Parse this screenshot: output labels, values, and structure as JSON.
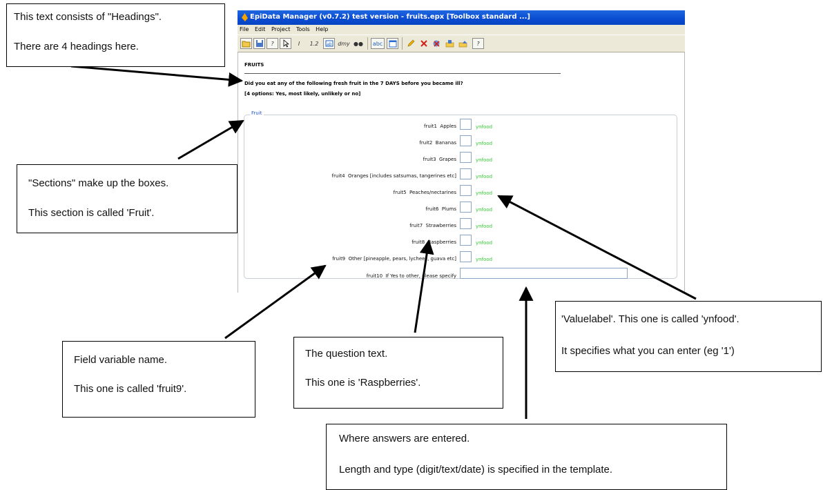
{
  "window": {
    "title": "EpiData Manager (v0.7.2) test version - fruits.epx [Toolbox standard ...]",
    "menu": [
      "File",
      "Edit",
      "Project",
      "Tools",
      "Help"
    ],
    "toolbar": {
      "integer": "I",
      "float": "1.2",
      "date": "dmy",
      "text": "abc"
    }
  },
  "form": {
    "headings": [
      "FRUITS",
      "Did you eat any of the following fresh fruit in the 7 DAYS before you became ill?",
      "[4 options: Yes, most likely, unlikely or no]"
    ],
    "section_name": "Fruit",
    "fields": [
      {
        "name": "fruit1",
        "question": "Apples",
        "valuelabel": "ynfood"
      },
      {
        "name": "fruit2",
        "question": "Bananas",
        "valuelabel": "ynfood"
      },
      {
        "name": "fruit3",
        "question": "Grapes",
        "valuelabel": "ynfood"
      },
      {
        "name": "fruit4",
        "question": "Oranges [includes satsumas, tangerines etc]",
        "valuelabel": "ynfood"
      },
      {
        "name": "fruit5",
        "question": "Peaches/nectarines",
        "valuelabel": "ynfood"
      },
      {
        "name": "fruit6",
        "question": "Plums",
        "valuelabel": "ynfood"
      },
      {
        "name": "fruit7",
        "question": "Strawberries",
        "valuelabel": "ynfood"
      },
      {
        "name": "fruit8",
        "question": "Raspberries",
        "valuelabel": "ynfood"
      },
      {
        "name": "fruit9",
        "question": "Other [pineapple, pears, lychees, guava etc]",
        "valuelabel": "ynfood"
      },
      {
        "name": "fruit10",
        "question": "If Yes to other, please specify",
        "valuelabel": ""
      }
    ]
  },
  "callouts": {
    "headings": [
      "This text consists of \"Headings\".",
      "There are 4 headings here."
    ],
    "sections": [
      "\"Sections\" make up the boxes.",
      "This section is called 'Fruit'."
    ],
    "field_name": [
      "Field variable name.",
      "This one is called 'fruit9'."
    ],
    "question_text": [
      "The question text.",
      "This one is 'Raspberries'."
    ],
    "valuelabel": [
      "'Valuelabel'. This one is called 'ynfood'.",
      "It specifies what you can enter (eg '1')"
    ],
    "answers": [
      "Where answers are entered.",
      "Length and type (digit/text/date) is specified in the template."
    ]
  }
}
